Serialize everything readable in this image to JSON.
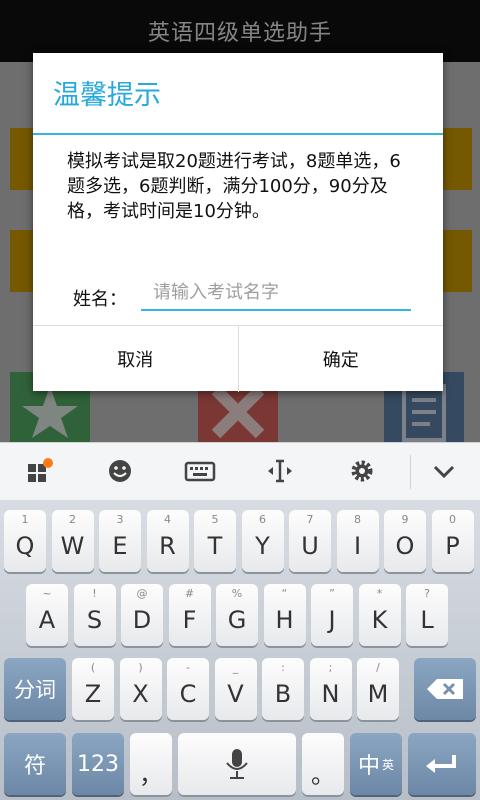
{
  "app": {
    "title": "英语四级单选助手"
  },
  "dialog": {
    "title": "温馨提示",
    "message": "模拟考试是取20题进行考试，8题单选，6题多选，6题判断，满分100分，90分及格，考试时间是10分钟。",
    "name_label": "姓名：",
    "name_placeholder": "请输入考试名字",
    "name_value": "",
    "cancel_label": "取消",
    "confirm_label": "确定"
  },
  "keyboard": {
    "toolbar": {
      "icons": [
        "app-grid-icon",
        "emoji-icon",
        "keyboard-icon",
        "cursor-move-icon",
        "gear-icon",
        "collapse-icon"
      ],
      "badge_color": "#ff7a1a"
    },
    "row1": [
      {
        "main": "Q",
        "sym": "1"
      },
      {
        "main": "W",
        "sym": "2"
      },
      {
        "main": "E",
        "sym": "3"
      },
      {
        "main": "R",
        "sym": "4"
      },
      {
        "main": "T",
        "sym": "5"
      },
      {
        "main": "Y",
        "sym": "6"
      },
      {
        "main": "U",
        "sym": "7"
      },
      {
        "main": "I",
        "sym": "8"
      },
      {
        "main": "O",
        "sym": "9"
      },
      {
        "main": "P",
        "sym": "0"
      }
    ],
    "row2": [
      {
        "main": "A",
        "sym": "~"
      },
      {
        "main": "S",
        "sym": "!"
      },
      {
        "main": "D",
        "sym": "@"
      },
      {
        "main": "F",
        "sym": "#"
      },
      {
        "main": "G",
        "sym": "%"
      },
      {
        "main": "H",
        "sym": "“"
      },
      {
        "main": "J",
        "sym": "”"
      },
      {
        "main": "K",
        "sym": "*"
      },
      {
        "main": "L",
        "sym": "?"
      }
    ],
    "row3": [
      {
        "main": "Z",
        "sym": "("
      },
      {
        "main": "X",
        "sym": ")"
      },
      {
        "main": "C",
        "sym": "-"
      },
      {
        "main": "V",
        "sym": "_"
      },
      {
        "main": "B",
        "sym": ":"
      },
      {
        "main": "N",
        "sym": ";"
      },
      {
        "main": "M",
        "sym": "/"
      }
    ],
    "fenci_label": "分词",
    "symbol_label": "符",
    "num_label": "123",
    "comma_label": "，",
    "period_label": "。",
    "lang_main": "中",
    "lang_sub": "英"
  }
}
